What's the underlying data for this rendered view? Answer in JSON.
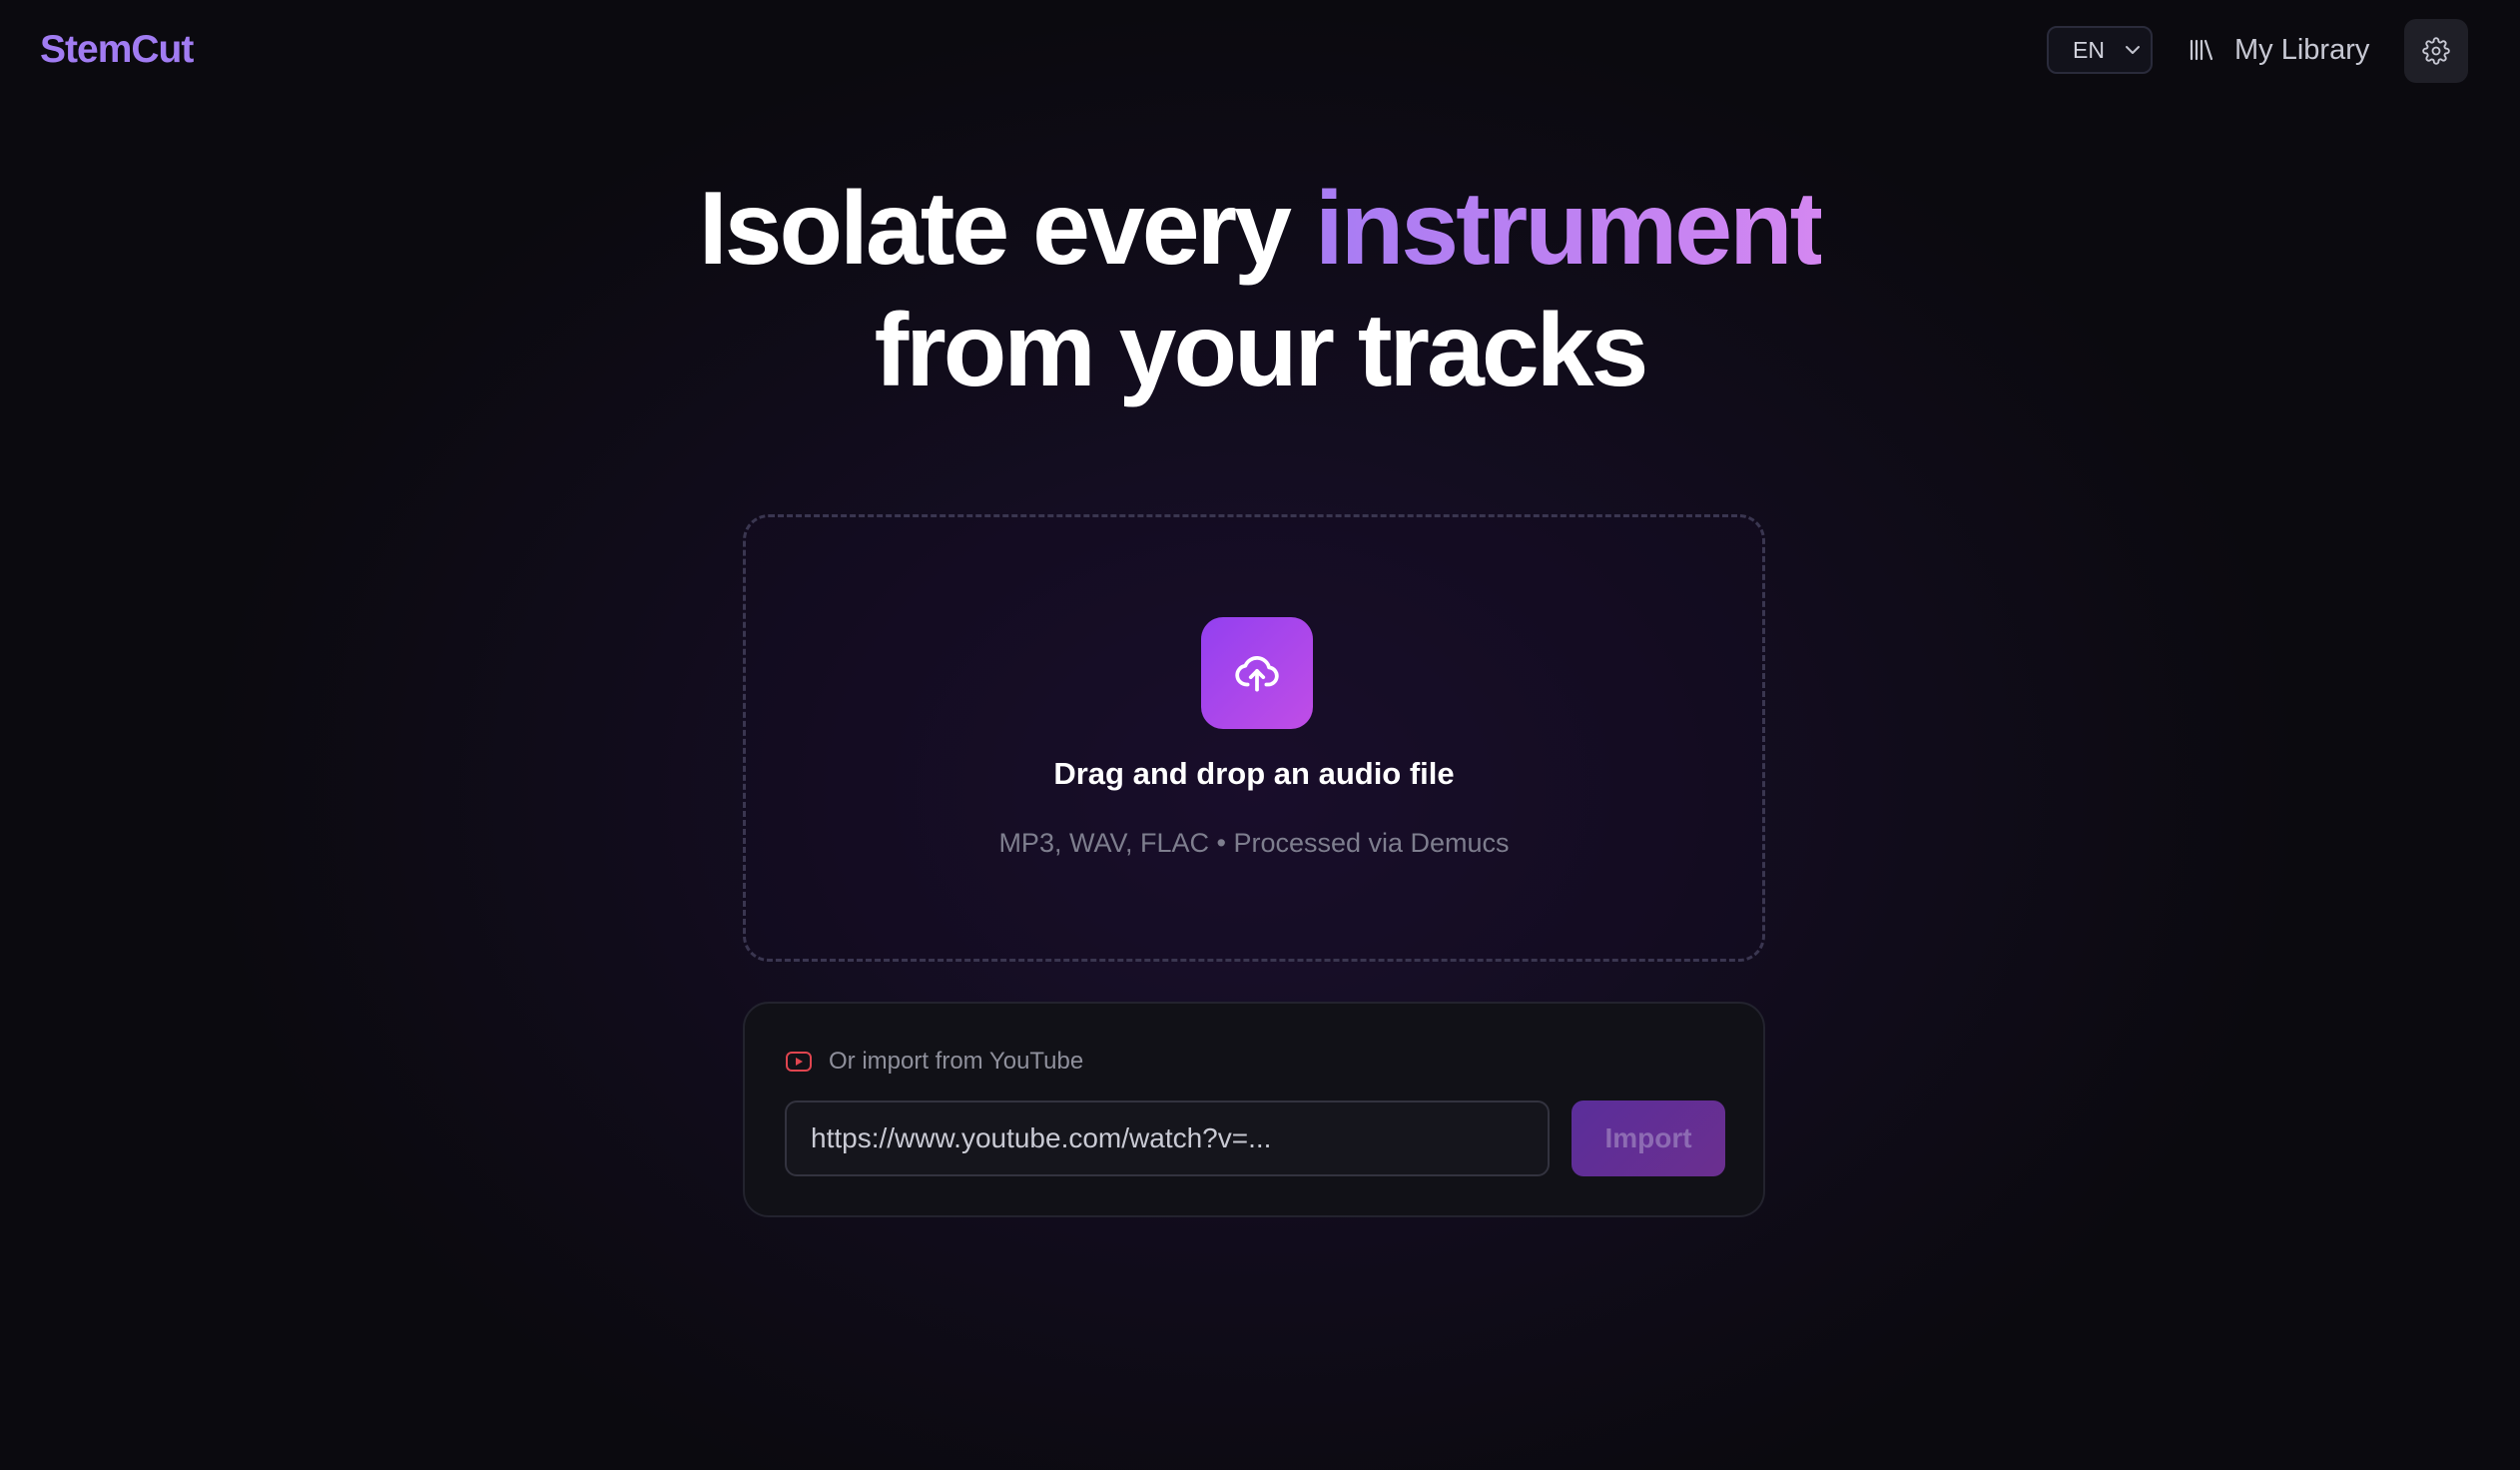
{
  "header": {
    "brand": "StemCut",
    "language": "EN",
    "library_label": "My Library",
    "icons": {
      "language_caret": "chevron-down-icon",
      "library": "library-icon",
      "settings": "gear-icon"
    }
  },
  "hero": {
    "line1_prefix": "Isolate every ",
    "line1_accent": "instrument",
    "line2": "from your tracks"
  },
  "dropzone": {
    "icon": "cloud-upload-icon",
    "title": "Drag and drop an audio file",
    "subtitle": "MP3, WAV, FLAC • Processed via Demucs"
  },
  "youtube": {
    "icon": "youtube-icon",
    "label": "Or import from YouTube",
    "placeholder": "https://www.youtube.com/watch?v=...",
    "button_label": "Import"
  },
  "colors": {
    "brand": "#a17cf2",
    "accent_start": "#a77cf3",
    "accent_end": "#d487f1",
    "upload_tile_start": "#9340f0",
    "upload_tile_end": "#c04de6",
    "youtube_red": "#e0454f",
    "import_button": "#5a2e9a"
  }
}
